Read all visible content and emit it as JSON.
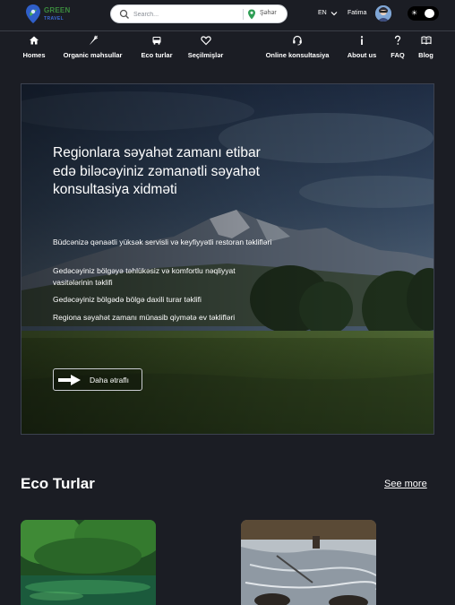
{
  "brand": {
    "name": "GREEN",
    "sub": "TRAVEL"
  },
  "search": {
    "placeholder": "Search...",
    "city": "Şəhər"
  },
  "header": {
    "lang": "EN",
    "user_name": "Fatima"
  },
  "nav": [
    {
      "label": "Homes",
      "icon": "home-icon"
    },
    {
      "label": "Organic məhsullar",
      "icon": "carrot-icon"
    },
    {
      "label": "Eco turlar",
      "icon": "bus-icon"
    },
    {
      "label": "Seçilmişlər",
      "icon": "heart-icon"
    },
    {
      "label": "Online konsultasiya",
      "icon": "headset-icon"
    },
    {
      "label": "About us",
      "icon": "info-icon"
    },
    {
      "label": "FAQ",
      "icon": "question-icon"
    },
    {
      "label": "Blog",
      "icon": "book-icon"
    }
  ],
  "hero": {
    "title": "Regionlara səyahət zamanı etibar edə biləcəyiniz zəmanətli səyahət konsultasiya xidməti",
    "features": [
      "Büdcənizə qənaətli yüksək servisli və keyfiyyətli restoran təklifləri",
      "Gedəcəyiniz bölgəyə təhlükəsiz və komfortlu nəqliyyat vasitələrinin təklifi",
      "Gedəcəyiniz bölgədə bölgə daxili turar təklifi",
      "Regiona səyahət zamanı münasib qiymətə ev təklifləri"
    ],
    "button_label": "Daha ətraflı"
  },
  "eco_section": {
    "title": "Eco Turlar",
    "see_more": "See more"
  }
}
